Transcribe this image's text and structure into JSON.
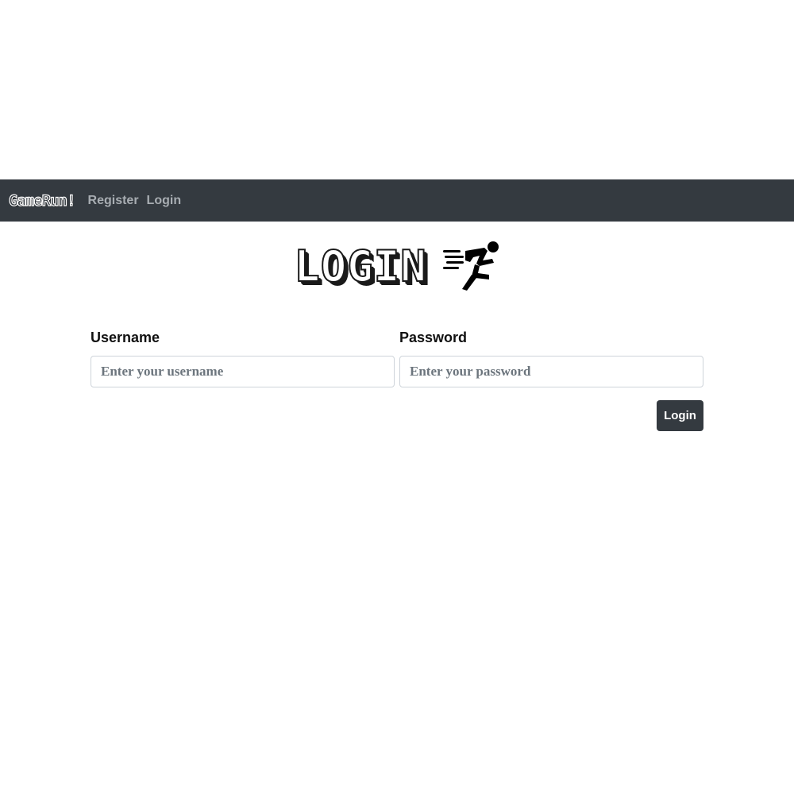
{
  "navbar": {
    "brand": "GameRun!",
    "links": [
      {
        "label": "Register"
      },
      {
        "label": "Login"
      }
    ],
    "background": "#343a40",
    "link_color": "#a8adb2"
  },
  "heading": {
    "title": "LOGIN",
    "icon": "running-man-icon"
  },
  "form": {
    "username": {
      "label": "Username",
      "placeholder": "Enter your username",
      "value": ""
    },
    "password": {
      "label": "Password",
      "placeholder": "Enter your password",
      "value": ""
    },
    "submit_label": "Login",
    "submit_color": "#343a40"
  }
}
